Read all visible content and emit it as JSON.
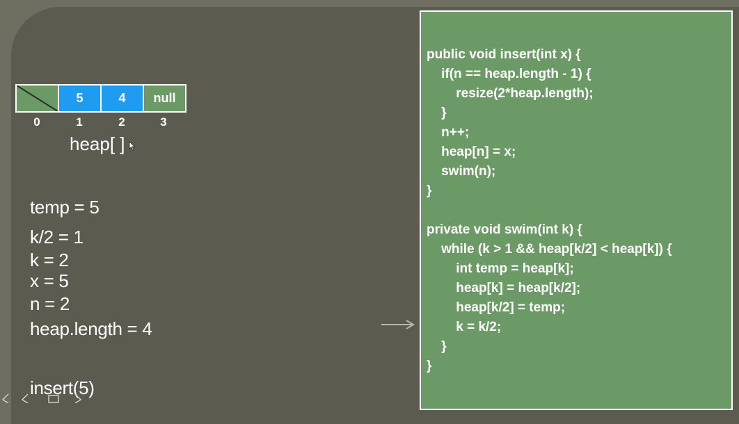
{
  "heap": {
    "cells": [
      "",
      "5",
      "4",
      "null"
    ],
    "indices": [
      "0",
      "1",
      "2",
      "3"
    ],
    "label": "heap[ ]"
  },
  "vars": {
    "temp": "temp = 5",
    "k_half": "k/2 = 1",
    "k": "k = 2",
    "x": "x = 5",
    "n": "n = 2",
    "heap_length": "heap.length = 4",
    "call": "insert(5)"
  },
  "code": {
    "insert": [
      "public void insert(int x) {",
      "    if(n == heap.length - 1) {",
      "        resize(2*heap.length);",
      "    }",
      "    n++;",
      "    heap[n] = x;",
      "    swim(n);",
      "}"
    ],
    "swim": [
      "private void swim(int k) {",
      "    while (k > 1 && heap[k/2] < heap[k]) {",
      "        int temp = heap[k];",
      "        heap[k] = heap[k/2];",
      "        heap[k/2] = temp;",
      "        k = k/2;",
      "    }",
      "}"
    ]
  },
  "colors": {
    "background": "#5b5c4f",
    "code_panel": "#6b9a66",
    "cell_blue": "#1f9bf0",
    "text": "#ffffff"
  }
}
